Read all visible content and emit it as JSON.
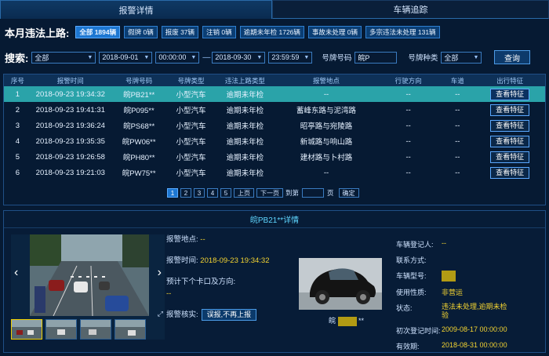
{
  "tabs": [
    {
      "label": "报警详情",
      "active": true
    },
    {
      "label": "车辆追踪",
      "active": false
    }
  ],
  "summary": {
    "title": "本月违法上路:",
    "chips": [
      {
        "label": "全部 1894辆",
        "active": true
      },
      {
        "label": "假牌 0辆"
      },
      {
        "label": "报废 37辆"
      },
      {
        "label": "注销 0辆"
      },
      {
        "label": "逾期未年检 1726辆"
      },
      {
        "label": "事故未处理 0辆"
      },
      {
        "label": "多宗违法未处理 131辆"
      }
    ]
  },
  "search": {
    "label": "搜索:",
    "scope": "全部",
    "start_date": "2018-09-01",
    "start_time": "00:00:00",
    "dash": "—",
    "end_date": "2018-09-30",
    "end_time": "23:59:59",
    "plate_label": "号牌号码",
    "plate_value": "皖P",
    "type_label": "号牌种类",
    "type_value": "全部",
    "query_button": "查询"
  },
  "table": {
    "columns": [
      "序号",
      "报警时间",
      "号牌号码",
      "号牌类型",
      "违法上路类型",
      "报警地点",
      "行驶方向",
      "车道",
      "出行特征"
    ],
    "rows": [
      {
        "no": "1",
        "time": "2018-09-23 19:34:32",
        "plate": "皖PB21**",
        "type": "小型汽车",
        "violation": "逾期未年检",
        "location": "--",
        "direction": "--",
        "lane": "--",
        "action": "查看特征"
      },
      {
        "no": "2",
        "time": "2018-09-23 19:41:31",
        "plate": "皖P095**",
        "type": "小型汽车",
        "violation": "逾期未年检",
        "location": "蓄峰东路与泥湾路",
        "direction": "--",
        "lane": "--",
        "action": "查看特征"
      },
      {
        "no": "3",
        "time": "2018-09-23 19:36:24",
        "plate": "皖PS68**",
        "type": "小型汽车",
        "violation": "逾期未年检",
        "location": "昭亭路与宛陵路",
        "direction": "--",
        "lane": "--",
        "action": "查看特征"
      },
      {
        "no": "4",
        "time": "2018-09-23 19:35:35",
        "plate": "皖PW06**",
        "type": "小型汽车",
        "violation": "逾期未年检",
        "location": "新城路与响山路",
        "direction": "--",
        "lane": "--",
        "action": "查看特征"
      },
      {
        "no": "5",
        "time": "2018-09-23 19:26:58",
        "plate": "皖PH80**",
        "type": "小型汽车",
        "violation": "逾期未年检",
        "location": "建材路与卜村路",
        "direction": "--",
        "lane": "--",
        "action": "查看特征"
      },
      {
        "no": "6",
        "time": "2018-09-23 19:21:03",
        "plate": "皖PW75**",
        "type": "小型汽车",
        "violation": "逾期未年检",
        "location": "--",
        "direction": "--",
        "lane": "--",
        "action": "查看特征"
      }
    ],
    "selected_row": 0
  },
  "pager": {
    "pages": [
      "1",
      "2",
      "3",
      "4",
      "5"
    ],
    "current": "1",
    "prev": "上页",
    "next": "下一页",
    "goto_label": "到第",
    "page_unit": "页",
    "confirm": "确定"
  },
  "detail": {
    "title": "皖PB21**详情",
    "alarm_location_label": "报警地点:",
    "alarm_location_value": "--",
    "alarm_time_label": "报警时间:",
    "alarm_time_value": "2018-09-23 19:34:32",
    "next_checkpoint_label": "预计下个卡口及方向:",
    "next_checkpoint_value": "--",
    "verify_label": "报警核实:",
    "verify_button": "误报,不再上报",
    "plate_caption_prefix": "皖",
    "plate_caption_suffix": "**",
    "vehicle": [
      {
        "key": "车辆登记人:",
        "value": "--"
      },
      {
        "key": "联系方式:",
        "value": ""
      },
      {
        "key": "车辆型号:",
        "value": ""
      },
      {
        "key": "使用性质:",
        "value": "非营运"
      },
      {
        "key": "状态:",
        "value": "违法未处理,逾期未检验"
      },
      {
        "key": "初次登记时间:",
        "value": "2009-08-17 00:00:00"
      },
      {
        "key": "有效期:",
        "value": "2018-08-31 00:00:00"
      }
    ]
  },
  "colors": {
    "accent": "#1d77d2",
    "selected_row": "#2aa3a9",
    "value_yellow": "#f4d431",
    "title_cyan": "#5fd6ff"
  }
}
